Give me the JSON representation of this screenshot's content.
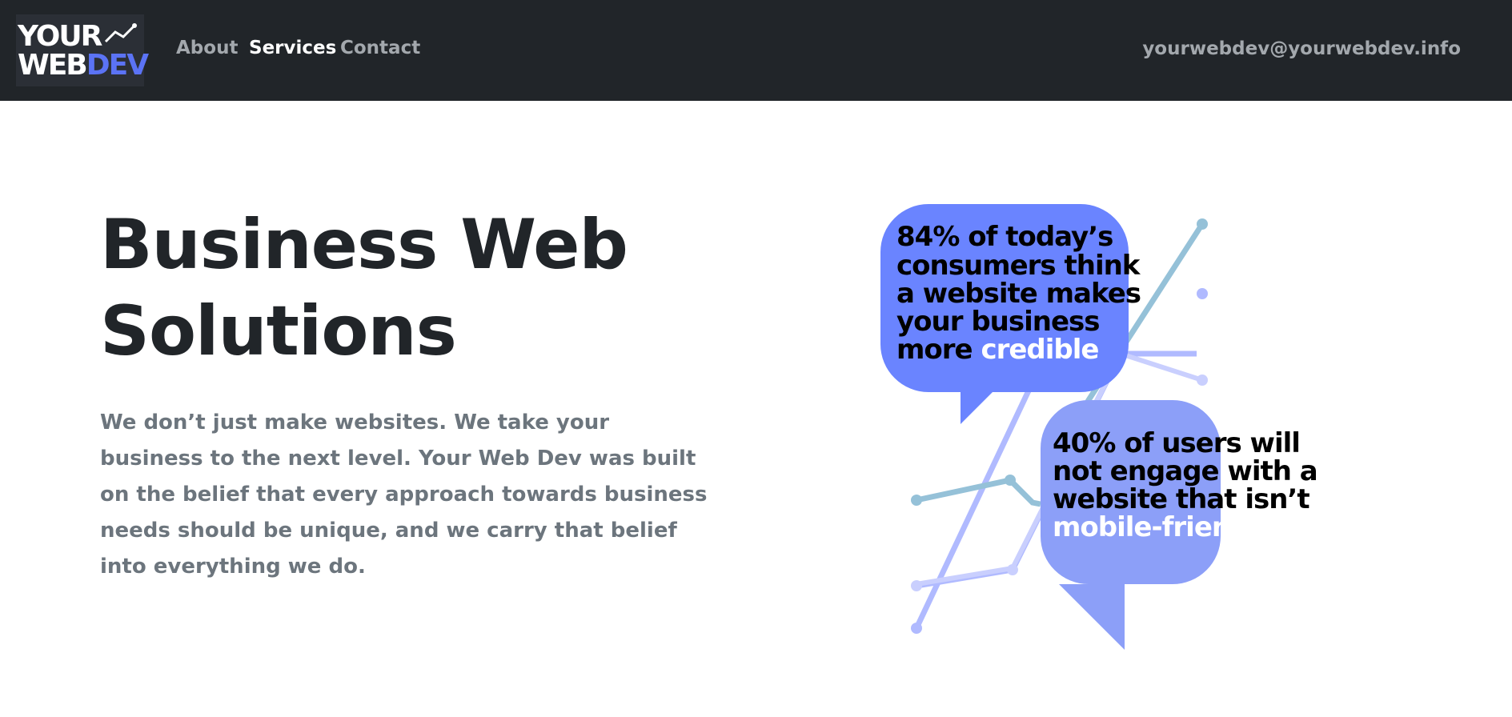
{
  "brand": {
    "logo_line1": "YOUR",
    "logo_line2_main": "WEB",
    "logo_line2_accent": "DEV"
  },
  "nav": {
    "links": [
      {
        "label": "About",
        "active": false
      },
      {
        "label": "Services",
        "active": true
      },
      {
        "label": "Contact",
        "active": false
      }
    ],
    "email": "yourwebdev@yourwebdev.info"
  },
  "hero": {
    "title": "Business Web Solutions",
    "description": "We don’t just make websites. We take your business to the next level. Your Web Dev was built on the belief that every approach towards business needs should be unique, and we carry that belief into everything we do."
  },
  "graphic": {
    "bubble1": {
      "lines": [
        "84% of today’s",
        "consumers think",
        "a website makes",
        "your business"
      ],
      "last_prefix": "more ",
      "highlight": "credible"
    },
    "bubble2": {
      "lines": [
        "40% of users will",
        "not engage with a",
        "website that isn’t"
      ],
      "highlight": "mobile-friendly"
    }
  },
  "colors": {
    "navbar_bg": "#212529",
    "accent": "#5b73f5",
    "bubble1": "#6a84ff",
    "bubble2": "#8c9ff8"
  }
}
